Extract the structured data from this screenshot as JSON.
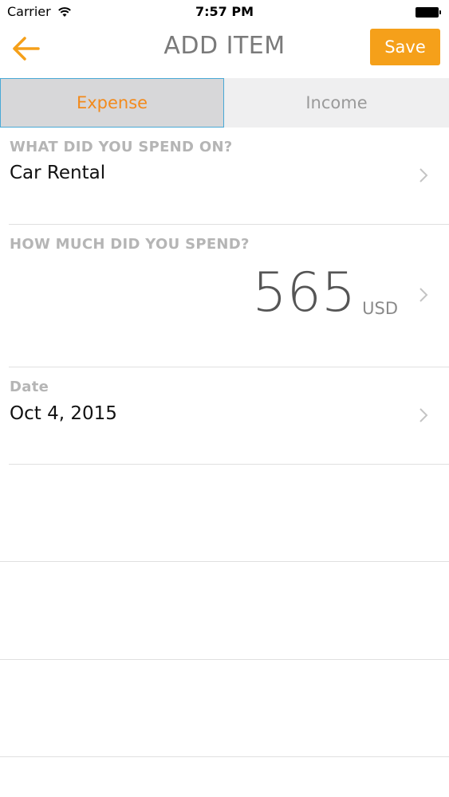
{
  "status_bar": {
    "carrier": "Carrier",
    "time": "7:57 PM"
  },
  "nav": {
    "title": "ADD ITEM",
    "save_label": "Save"
  },
  "segments": {
    "expense": "Expense",
    "income": "Income"
  },
  "category": {
    "label": "WHAT DID YOU SPEND ON?",
    "value": "Car Rental"
  },
  "amount": {
    "label": "HOW MUCH DID YOU SPEND?",
    "value": "565",
    "currency": "USD"
  },
  "date": {
    "label": "Date",
    "value": "Oct 4, 2015"
  },
  "colors": {
    "accent": "#f5a01a",
    "active_text": "#f28a1c",
    "active_border": "#49a9d6"
  }
}
